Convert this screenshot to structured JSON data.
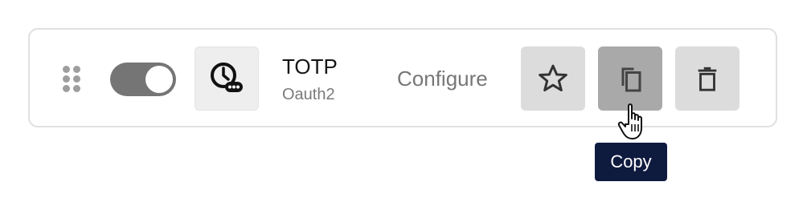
{
  "item": {
    "title": "TOTP",
    "subtitle": "Oauth2",
    "enabled": true,
    "configure_label": "Configure"
  },
  "icons": {
    "drag": "drag-handle-icon",
    "app": "clock-otp-icon",
    "star": "star-icon",
    "copy": "copy-icon",
    "delete": "trash-icon",
    "cursor": "hand-pointer-icon"
  },
  "tooltip": {
    "text": "Copy"
  },
  "colors": {
    "toggle_on": "#757575",
    "button_bg": "#dcdcdc",
    "button_hover_bg": "#a9a9a9",
    "tooltip_bg": "#0f1a3f"
  }
}
